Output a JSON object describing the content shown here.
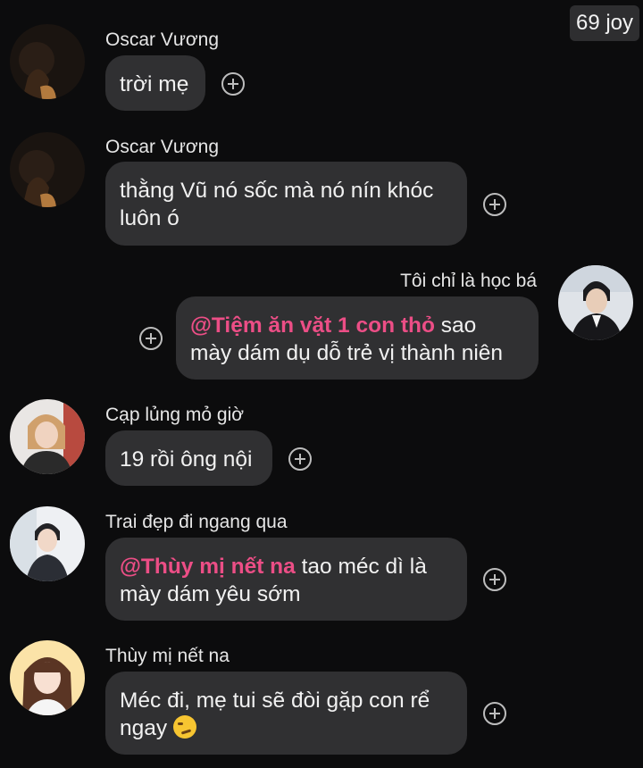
{
  "header": {
    "badge": "69 joy"
  },
  "messages": [
    {
      "sender": "Oscar Vương",
      "text": "trời mẹ",
      "avatar": "avatar-oscar"
    },
    {
      "sender": "Oscar Vương",
      "line1": "thằng Vũ nó sốc mà nó nín khóc",
      "line2": "luôn ó",
      "avatar": "avatar-oscar"
    },
    {
      "sender": "Tôi chỉ là học bá",
      "mention": "@Tiệm ăn vặt 1 con thỏ",
      "line1_rest": " sao",
      "line2": "mày dám dụ dỗ trẻ vị thành niên",
      "avatar": "avatar-hocba",
      "outgoing": true
    },
    {
      "sender": "Cạp lủng mỏ giờ",
      "text": "19 rồi ông nội",
      "avatar": "avatar-caplung"
    },
    {
      "sender": "Trai đẹp đi ngang qua",
      "mention": "@Thùy mị nết na",
      "line1_rest": " tao méc dì là",
      "line2": "mày dám yêu sớm",
      "avatar": "avatar-traidep"
    },
    {
      "sender": "Thùy mị nết na",
      "line1": "Méc đi, mẹ tui sẽ đòi gặp con rể",
      "line2": "ngay",
      "emoji": "smirking-face-emoji",
      "avatar": "avatar-thuymi"
    }
  ],
  "colors": {
    "background": "#0c0c0d",
    "bubble": "#303032",
    "mention": "#ec4e86",
    "badge_bg": "#2e2e30"
  },
  "icons": [
    "add-reaction-icon"
  ]
}
